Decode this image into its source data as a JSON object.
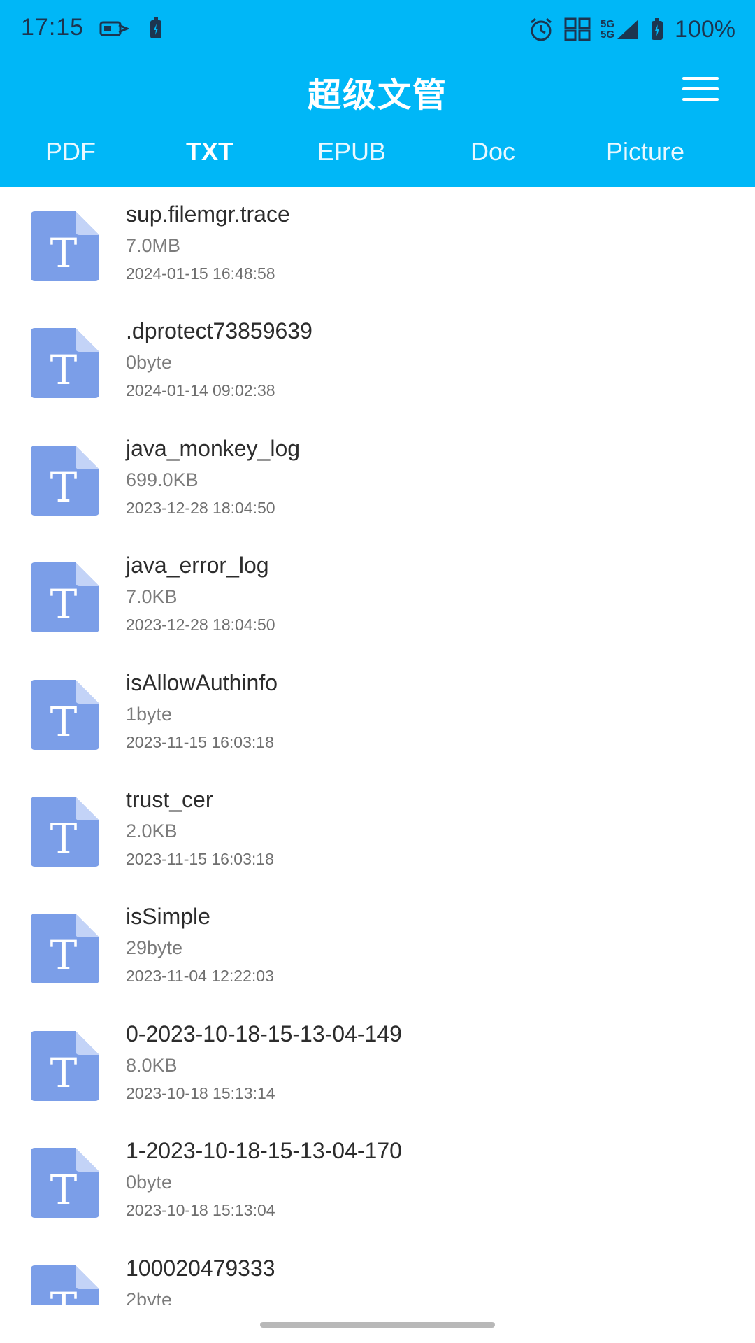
{
  "status_bar": {
    "time": "17:15",
    "network": "5G",
    "battery": "100%"
  },
  "app": {
    "title": "超级文管"
  },
  "tabs": [
    {
      "label": "PDF",
      "active": false
    },
    {
      "label": "TXT",
      "active": true
    },
    {
      "label": "EPUB",
      "active": false
    },
    {
      "label": "Doc",
      "active": false
    },
    {
      "label": "Picture",
      "active": false
    }
  ],
  "colors": {
    "header_bg": "#00b7f7",
    "icon_blue": "#7b9ee8",
    "icon_fold": "#c3d3f7"
  },
  "file_icon_glyph": "T",
  "files": [
    {
      "name": "sup.filemgr.trace",
      "size": "7.0MB",
      "date": "2024-01-15 16:48:58"
    },
    {
      "name": ".dprotect73859639",
      "size": "0byte",
      "date": "2024-01-14 09:02:38"
    },
    {
      "name": "java_monkey_log",
      "size": "699.0KB",
      "date": "2023-12-28 18:04:50"
    },
    {
      "name": "java_error_log",
      "size": "7.0KB",
      "date": "2023-12-28 18:04:50"
    },
    {
      "name": "isAllowAuthinfo",
      "size": "1byte",
      "date": "2023-11-15 16:03:18"
    },
    {
      "name": "trust_cer",
      "size": "2.0KB",
      "date": "2023-11-15 16:03:18"
    },
    {
      "name": "isSimple",
      "size": "29byte",
      "date": "2023-11-04 12:22:03"
    },
    {
      "name": "0-2023-10-18-15-13-04-149",
      "size": "8.0KB",
      "date": "2023-10-18 15:13:14"
    },
    {
      "name": "1-2023-10-18-15-13-04-170",
      "size": "0byte",
      "date": "2023-10-18 15:13:04"
    },
    {
      "name": "100020479333",
      "size": "2byte",
      "date": ""
    }
  ]
}
